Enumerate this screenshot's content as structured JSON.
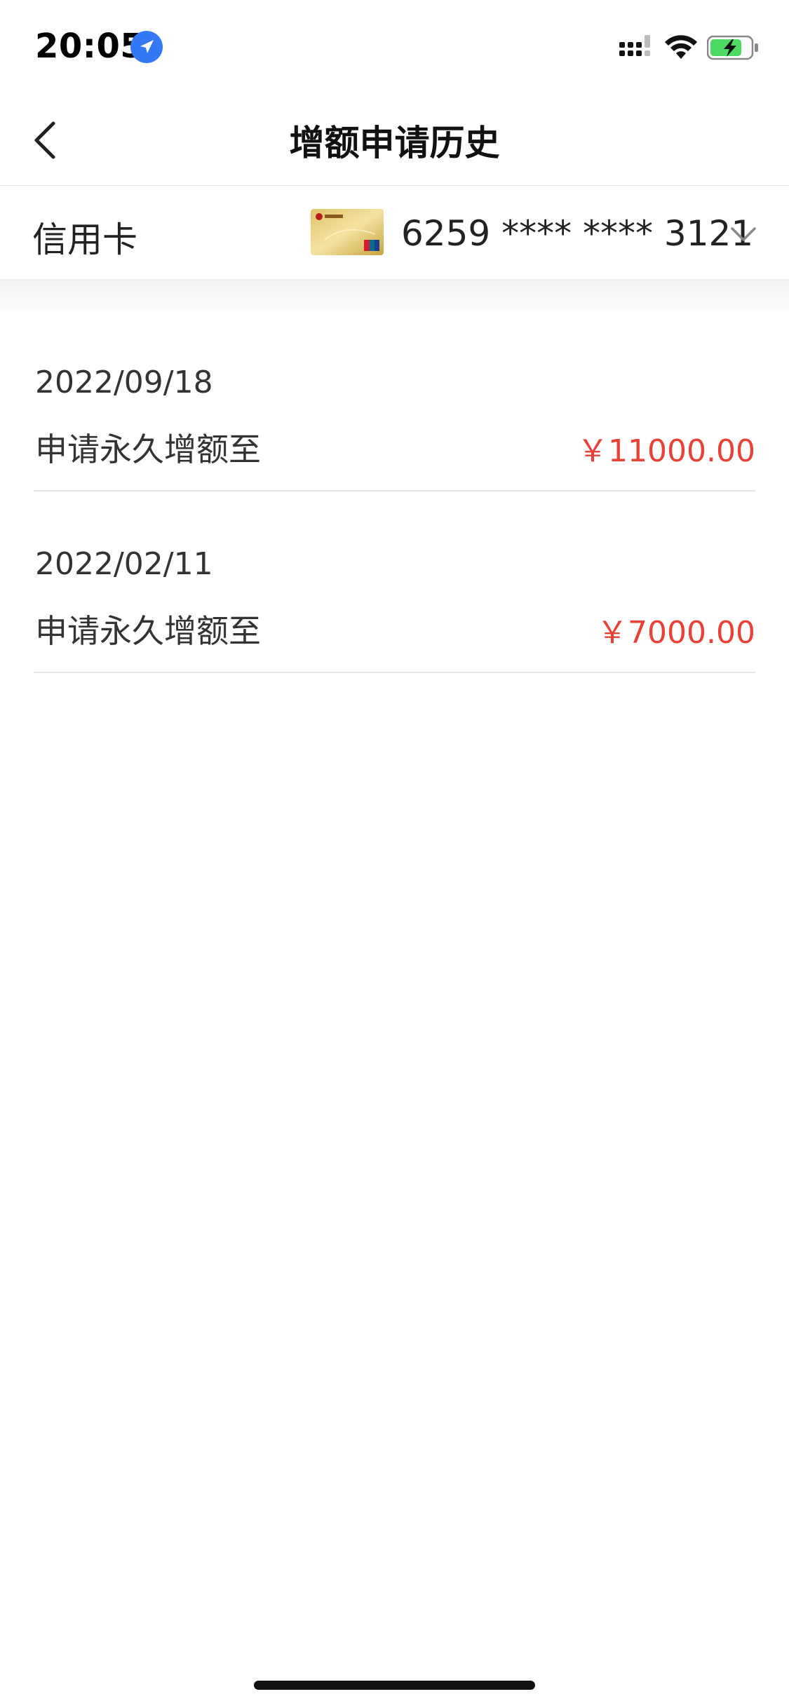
{
  "status_bar": {
    "time": "20:05",
    "location_icon": "location-arrow-icon",
    "signal_icon": "cellular-signal-icon",
    "wifi_icon": "wifi-icon",
    "battery_icon": "battery-charging-icon",
    "battery_color": "#4cd964"
  },
  "nav": {
    "back_icon": "chevron-left-icon",
    "title": "增额申请历史"
  },
  "card_selector": {
    "label": "信用卡",
    "card_icon": "bank-card-icon",
    "card_number": "6259 **** **** 3121",
    "dropdown_icon": "chevron-down-icon"
  },
  "history": [
    {
      "date": "2022/09/18",
      "description": "申请永久增额至",
      "amount": "￥11000.00"
    },
    {
      "date": "2022/02/11",
      "description": "申请永久增额至",
      "amount": "￥7000.00"
    }
  ],
  "colors": {
    "amount": "#e84135",
    "accent_blue": "#3478f6"
  }
}
